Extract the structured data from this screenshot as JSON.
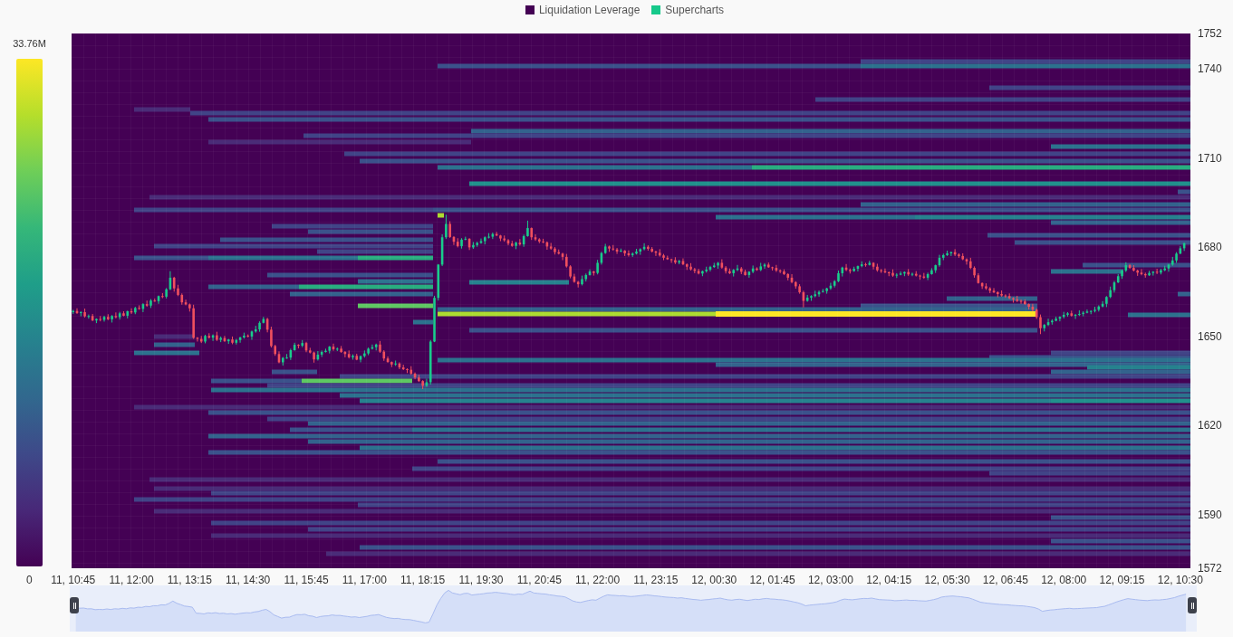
{
  "legend": [
    {
      "label": "Liquidation Leverage",
      "color": "#440154"
    },
    {
      "label": "Supercharts",
      "color": "#17c98b"
    }
  ],
  "color_scale": {
    "max_label": "33.76M",
    "min_label": "0"
  },
  "heatmap": {
    "chart_data": {
      "type": "candlestick",
      "ylim": [
        1572,
        1752
      ],
      "yticks": [
        {
          "value": 1752,
          "label": "1752"
        },
        {
          "value": 1740,
          "label": "1740"
        },
        {
          "value": 1710,
          "label": "1710"
        },
        {
          "value": 1680,
          "label": "1680"
        },
        {
          "value": 1650,
          "label": "1650"
        },
        {
          "value": 1620,
          "label": "1620"
        },
        {
          "value": 1590,
          "label": "1590"
        },
        {
          "value": 1572,
          "label": "1572"
        }
      ],
      "categories": [
        "11, 10:45",
        null,
        null,
        null,
        null,
        null,
        null,
        null,
        null,
        null,
        null,
        null,
        null,
        null,
        null,
        "11, 12:00",
        null,
        null,
        null,
        null,
        null,
        null,
        null,
        null,
        null,
        null,
        null,
        null,
        null,
        null,
        "11, 13:15",
        null,
        null,
        null,
        null,
        null,
        null,
        null,
        null,
        null,
        null,
        null,
        null,
        null,
        null,
        "11, 14:30",
        null,
        null,
        null,
        null,
        null,
        null,
        null,
        null,
        null,
        null,
        null,
        null,
        null,
        null,
        "11, 15:45",
        null,
        null,
        null,
        null,
        null,
        null,
        null,
        null,
        null,
        null,
        null,
        null,
        null,
        null,
        "11, 17:00",
        null,
        null,
        null,
        null,
        null,
        null,
        null,
        null,
        null,
        null,
        null,
        null,
        null,
        null,
        "11, 18:15",
        null,
        null,
        null,
        null,
        null,
        null,
        null,
        null,
        null,
        null,
        null,
        null,
        null,
        null,
        "11, 19:30",
        null,
        null,
        null,
        null,
        null,
        null,
        null,
        null,
        null,
        null,
        null,
        null,
        null,
        null,
        "11, 20:45",
        null,
        null,
        null,
        null,
        null,
        null,
        null,
        null,
        null,
        null,
        null,
        null,
        null,
        null,
        "11, 22:00",
        null,
        null,
        null,
        null,
        null,
        null,
        null,
        null,
        null,
        null,
        null,
        null,
        null,
        null,
        "11, 23:15",
        null,
        null,
        null,
        null,
        null,
        null,
        null,
        null,
        null,
        null,
        null,
        null,
        null,
        null,
        "12, 00:30",
        null,
        null,
        null,
        null,
        null,
        null,
        null,
        null,
        null,
        null,
        null,
        null,
        null,
        null,
        "12, 01:45",
        null,
        null,
        null,
        null,
        null,
        null,
        null,
        null,
        null,
        null,
        null,
        null,
        null,
        null,
        "12, 03:00",
        null,
        null,
        null,
        null,
        null,
        null,
        null,
        null,
        null,
        null,
        null,
        null,
        null,
        null,
        "12, 04:15",
        null,
        null,
        null,
        null,
        null,
        null,
        null,
        null,
        null,
        null,
        null,
        null,
        null,
        null,
        "12, 05:30",
        null,
        null,
        null,
        null,
        null,
        null,
        null,
        null,
        null,
        null,
        null,
        null,
        null,
        null,
        "12, 06:45",
        null,
        null,
        null,
        null,
        null,
        null,
        null,
        null,
        null,
        null,
        null,
        null,
        null,
        null,
        "12, 08:00",
        null,
        null,
        null,
        null,
        null,
        null,
        null,
        null,
        null,
        null,
        null,
        null,
        null,
        null,
        "12, 09:15",
        null,
        null,
        null,
        null,
        null,
        null,
        null,
        null,
        null,
        null,
        null,
        null,
        null,
        null,
        "12, 10:30",
        null
      ],
      "ohlc": [
        [
          1658.2,
          1659.0,
          1657.6,
          1658.6
        ],
        [
          1658.6,
          1659.5,
          1657.6,
          1657.9
        ],
        [
          1657.9,
          1658.5,
          1656.8,
          1658.2
        ],
        [
          1658.2,
          1659.4,
          1656.4,
          1656.8
        ],
        [
          1656.8,
          1657.4,
          1656.0,
          1656.9
        ],
        [
          1656.9,
          1657.6,
          1655.2,
          1655.4
        ],
        [
          1655.4,
          1656.1,
          1654.5,
          1655.9
        ],
        [
          1655.9,
          1656.9,
          1655.1,
          1655.6
        ],
        [
          1655.6,
          1657.0,
          1655.0,
          1656.6
        ],
        [
          1656.6,
          1657.5,
          1655.5,
          1655.8
        ],
        [
          1655.8,
          1657.2,
          1654.7,
          1656.9
        ],
        [
          1656.9,
          1658.1,
          1656.1,
          1656.5
        ],
        [
          1656.5,
          1658.3,
          1655.7,
          1657.8
        ],
        [
          1657.8,
          1658.5,
          1656.8,
          1657.0
        ],
        [
          1657.0,
          1658.7,
          1656.1,
          1658.5
        ],
        [
          1658.5,
          1659.5,
          1657.6,
          1658.1
        ],
        [
          1658.1,
          1660.0,
          1657.5,
          1659.6
        ],
        [
          1659.6,
          1660.5,
          1659.0,
          1659.3
        ],
        [
          1659.3,
          1661.2,
          1658.2,
          1660.9
        ],
        [
          1660.9,
          1662.1,
          1660.0,
          1660.4
        ],
        [
          1660.4,
          1662.6,
          1659.6,
          1662.1
        ],
        [
          1662.1,
          1662.8,
          1661.7,
          1661.9
        ],
        [
          1661.9,
          1663.8,
          1661.0,
          1663.6
        ],
        [
          1663.6,
          1664.6,
          1662.9,
          1663.4
        ],
        [
          1663.4,
          1666.3,
          1662.8,
          1665.9
        ],
        [
          1665.9,
          1672.0,
          1665.6,
          1669.8
        ],
        [
          1669.8,
          1670.1,
          1665.1,
          1666.2
        ],
        [
          1666.2,
          1667.4,
          1663.6,
          1664.0
        ],
        [
          1664.0,
          1664.5,
          1660.7,
          1661.5
        ],
        [
          1661.5,
          1662.4,
          1660.5,
          1660.8
        ],
        [
          1660.8,
          1661.1,
          1658.4,
          1659.5
        ],
        [
          1659.5,
          1660.7,
          1649.2,
          1649.6
        ],
        [
          1649.6,
          1649.8,
          1648.3,
          1649.2
        ],
        [
          1649.2,
          1650.2,
          1647.8,
          1648.3
        ],
        [
          1648.3,
          1650.6,
          1647.7,
          1650.2
        ],
        [
          1650.2,
          1651.1,
          1649.3,
          1649.6
        ],
        [
          1649.6,
          1650.7,
          1648.5,
          1650.4
        ],
        [
          1650.4,
          1651.6,
          1648.5,
          1648.9
        ],
        [
          1648.9,
          1650.0,
          1648.1,
          1649.5
        ],
        [
          1649.5,
          1650.2,
          1648.2,
          1648.4
        ],
        [
          1648.4,
          1649.2,
          1647.5,
          1649.0
        ],
        [
          1649.0,
          1650.0,
          1647.4,
          1647.9
        ],
        [
          1647.9,
          1649.2,
          1647.3,
          1648.8
        ],
        [
          1648.8,
          1649.9,
          1647.9,
          1649.7
        ],
        [
          1649.7,
          1651.3,
          1649.3,
          1650.3
        ],
        [
          1650.3,
          1650.7,
          1649.7,
          1650.0
        ],
        [
          1650.0,
          1652.0,
          1648.9,
          1651.7
        ],
        [
          1651.7,
          1653.6,
          1651.3,
          1652.4
        ],
        [
          1652.4,
          1655.1,
          1651.6,
          1654.6
        ],
        [
          1654.6,
          1656.6,
          1654.4,
          1655.9
        ],
        [
          1655.9,
          1656.3,
          1651.4,
          1652.3
        ],
        [
          1652.3,
          1653.3,
          1646.3,
          1646.8
        ],
        [
          1646.8,
          1647.2,
          1643.5,
          1644.1
        ],
        [
          1644.1,
          1645.0,
          1641.0,
          1641.3
        ],
        [
          1641.3,
          1643.1,
          1640.2,
          1642.8
        ],
        [
          1642.8,
          1644.1,
          1642.5,
          1642.9
        ],
        [
          1642.9,
          1645.9,
          1642.1,
          1645.4
        ],
        [
          1645.4,
          1647.9,
          1645.2,
          1647.2
        ],
        [
          1647.2,
          1647.4,
          1646.0,
          1646.9
        ],
        [
          1646.9,
          1648.8,
          1646.4,
          1647.8
        ],
        [
          1647.8,
          1648.2,
          1644.7,
          1645.3
        ],
        [
          1645.3,
          1646.2,
          1644.3,
          1644.6
        ],
        [
          1644.6,
          1644.9,
          1641.2,
          1642.3
        ],
        [
          1642.3,
          1645.1,
          1641.9,
          1643.9
        ],
        [
          1643.9,
          1645.3,
          1643.1,
          1644.8
        ],
        [
          1644.8,
          1645.9,
          1644.6,
          1645.2
        ],
        [
          1645.2,
          1646.8,
          1644.3,
          1646.6
        ],
        [
          1646.6,
          1647.6,
          1645.2,
          1645.7
        ],
        [
          1645.7,
          1646.3,
          1645.1,
          1645.9
        ],
        [
          1645.9,
          1646.8,
          1644.5,
          1644.8
        ],
        [
          1644.8,
          1645.1,
          1643.0,
          1644.1
        ],
        [
          1644.1,
          1645.3,
          1642.6,
          1643.0
        ],
        [
          1643.0,
          1644.0,
          1642.2,
          1643.5
        ],
        [
          1643.5,
          1644.2,
          1642.0,
          1642.2
        ],
        [
          1642.2,
          1643.6,
          1641.3,
          1643.4
        ],
        [
          1643.4,
          1645.3,
          1642.9,
          1644.3
        ],
        [
          1644.3,
          1646.3,
          1643.7,
          1645.9
        ],
        [
          1645.9,
          1647.3,
          1645.6,
          1646.4
        ],
        [
          1646.4,
          1647.6,
          1645.3,
          1647.3
        ],
        [
          1647.3,
          1648.5,
          1644.5,
          1644.9
        ],
        [
          1644.9,
          1645.4,
          1641.8,
          1642.6
        ],
        [
          1642.6,
          1643.3,
          1641.2,
          1641.4
        ],
        [
          1641.4,
          1641.6,
          1639.7,
          1640.6
        ],
        [
          1640.6,
          1641.9,
          1640.1,
          1640.9
        ],
        [
          1640.9,
          1641.3,
          1639.0,
          1639.6
        ],
        [
          1639.6,
          1640.5,
          1638.7,
          1639.0
        ],
        [
          1639.0,
          1639.3,
          1637.7,
          1638.8
        ],
        [
          1638.8,
          1640.0,
          1637.1,
          1637.5
        ],
        [
          1637.5,
          1637.9,
          1635.6,
          1636.2
        ],
        [
          1636.2,
          1637.1,
          1634.7,
          1635.0
        ],
        [
          1635.0,
          1635.3,
          1632.3,
          1633.4
        ],
        [
          1633.4,
          1635.8,
          1633.0,
          1634.6
        ],
        [
          1634.6,
          1648.8,
          1633.8,
          1648.3
        ],
        [
          1648.3,
          1663.7,
          1648.1,
          1663.0
        ],
        [
          1663.0,
          1674.4,
          1662.1,
          1674.2
        ],
        [
          1674.2,
          1684.4,
          1673.7,
          1683.4
        ],
        [
          1683.4,
          1691.0,
          1682.8,
          1687.9
        ],
        [
          1687.9,
          1688.8,
          1683.2,
          1683.5
        ],
        [
          1683.5,
          1683.8,
          1680.8,
          1681.9
        ],
        [
          1681.9,
          1683.1,
          1680.0,
          1680.4
        ],
        [
          1680.4,
          1683.1,
          1679.6,
          1682.6
        ],
        [
          1682.6,
          1683.6,
          1682.4,
          1682.9
        ],
        [
          1682.9,
          1683.1,
          1679.1,
          1680.0
        ],
        [
          1680.0,
          1681.8,
          1679.5,
          1680.8
        ],
        [
          1680.8,
          1681.9,
          1680.2,
          1681.5
        ],
        [
          1681.5,
          1683.0,
          1681.2,
          1682.1
        ],
        [
          1682.1,
          1683.7,
          1681.0,
          1683.4
        ],
        [
          1683.4,
          1684.8,
          1683.0,
          1683.6
        ],
        [
          1683.6,
          1685.0,
          1682.8,
          1684.5
        ],
        [
          1684.5,
          1685.2,
          1683.8,
          1684.0
        ],
        [
          1684.0,
          1684.2,
          1682.1,
          1683.0
        ],
        [
          1683.0,
          1684.0,
          1681.9,
          1682.4
        ],
        [
          1682.4,
          1682.8,
          1680.7,
          1681.3
        ],
        [
          1681.3,
          1682.2,
          1680.2,
          1680.5
        ],
        [
          1680.5,
          1681.9,
          1679.4,
          1681.6
        ],
        [
          1681.6,
          1682.8,
          1680.6,
          1681.0
        ],
        [
          1681.0,
          1684.3,
          1680.2,
          1683.8
        ],
        [
          1683.8,
          1689.0,
          1683.6,
          1686.5
        ],
        [
          1686.5,
          1686.7,
          1682.5,
          1683.4
        ],
        [
          1683.4,
          1684.4,
          1682.2,
          1682.7
        ],
        [
          1682.7,
          1683.1,
          1681.4,
          1682.0
        ],
        [
          1682.0,
          1682.9,
          1681.4,
          1681.7
        ],
        [
          1681.7,
          1682.0,
          1679.2,
          1680.3
        ],
        [
          1680.3,
          1681.5,
          1679.2,
          1679.6
        ],
        [
          1679.6,
          1680.1,
          1677.6,
          1678.4
        ],
        [
          1678.4,
          1679.3,
          1677.6,
          1677.9
        ],
        [
          1677.9,
          1678.2,
          1675.7,
          1676.8
        ],
        [
          1676.8,
          1677.8,
          1673.2,
          1673.6
        ],
        [
          1673.6,
          1674.0,
          1669.6,
          1670.2
        ],
        [
          1670.2,
          1671.1,
          1668.1,
          1668.4
        ],
        [
          1668.4,
          1668.7,
          1666.5,
          1667.6
        ],
        [
          1667.6,
          1670.5,
          1667.2,
          1669.3
        ],
        [
          1669.3,
          1671.2,
          1668.5,
          1670.7
        ],
        [
          1670.7,
          1672.6,
          1670.5,
          1671.9
        ],
        [
          1671.9,
          1672.1,
          1670.5,
          1671.4
        ],
        [
          1671.4,
          1675.8,
          1670.9,
          1674.8
        ],
        [
          1674.8,
          1678.5,
          1674.2,
          1678.1
        ],
        [
          1678.1,
          1681.2,
          1677.8,
          1680.3
        ],
        [
          1680.3,
          1680.6,
          1678.5,
          1679.6
        ],
        [
          1679.6,
          1680.8,
          1678.9,
          1679.3
        ],
        [
          1679.3,
          1679.8,
          1677.8,
          1678.6
        ],
        [
          1678.6,
          1679.6,
          1678.4,
          1678.9
        ],
        [
          1678.9,
          1679.1,
          1677.1,
          1678.0
        ],
        [
          1678.0,
          1679.0,
          1676.9,
          1677.4
        ],
        [
          1677.4,
          1678.3,
          1676.8,
          1677.9
        ],
        [
          1677.9,
          1679.5,
          1677.6,
          1678.6
        ],
        [
          1678.6,
          1679.7,
          1677.5,
          1679.4
        ],
        [
          1679.4,
          1681.4,
          1679.0,
          1680.2
        ],
        [
          1680.2,
          1680.7,
          1678.9,
          1679.5
        ],
        [
          1679.5,
          1680.1,
          1678.3,
          1678.6
        ],
        [
          1678.6,
          1678.9,
          1677.1,
          1678.2
        ],
        [
          1678.2,
          1679.4,
          1676.9,
          1677.3
        ],
        [
          1677.3,
          1677.8,
          1675.7,
          1676.5
        ],
        [
          1676.5,
          1677.2,
          1675.8,
          1676.0
        ],
        [
          1676.0,
          1676.2,
          1674.8,
          1675.7
        ],
        [
          1675.7,
          1676.7,
          1674.4,
          1674.9
        ],
        [
          1674.9,
          1675.8,
          1674.3,
          1675.4
        ],
        [
          1675.4,
          1676.3,
          1674.0,
          1674.3
        ],
        [
          1674.3,
          1674.6,
          1672.4,
          1673.5
        ],
        [
          1673.5,
          1674.7,
          1672.2,
          1672.6
        ],
        [
          1672.6,
          1673.1,
          1671.3,
          1672.1
        ],
        [
          1672.1,
          1672.8,
          1670.9,
          1671.2
        ],
        [
          1671.2,
          1672.2,
          1670.3,
          1672.0
        ],
        [
          1672.0,
          1673.5,
          1671.5,
          1672.5
        ],
        [
          1672.5,
          1673.8,
          1671.9,
          1673.4
        ],
        [
          1673.4,
          1674.8,
          1673.1,
          1673.9
        ],
        [
          1673.9,
          1675.1,
          1672.8,
          1674.8
        ],
        [
          1674.8,
          1676.0,
          1672.8,
          1673.2
        ],
        [
          1673.2,
          1673.7,
          1671.2,
          1672.0
        ],
        [
          1672.0,
          1672.9,
          1671.0,
          1671.3
        ],
        [
          1671.3,
          1672.7,
          1670.2,
          1672.4
        ],
        [
          1672.4,
          1674.1,
          1672.0,
          1672.9
        ],
        [
          1672.9,
          1673.4,
          1671.0,
          1671.8
        ],
        [
          1671.8,
          1672.5,
          1670.5,
          1670.7
        ],
        [
          1670.7,
          1672.0,
          1669.8,
          1671.8
        ],
        [
          1671.8,
          1673.9,
          1671.3,
          1672.9
        ],
        [
          1672.9,
          1673.3,
          1672.1,
          1672.4
        ],
        [
          1672.4,
          1674.8,
          1672.0,
          1673.6
        ],
        [
          1673.6,
          1674.7,
          1672.8,
          1674.2
        ],
        [
          1674.2,
          1674.9,
          1673.1,
          1673.3
        ],
        [
          1673.3,
          1673.5,
          1672.2,
          1673.1
        ],
        [
          1673.1,
          1674.1,
          1671.7,
          1672.2
        ],
        [
          1672.2,
          1672.6,
          1671.3,
          1671.9
        ],
        [
          1671.9,
          1672.6,
          1670.7,
          1671.0
        ],
        [
          1671.0,
          1671.3,
          1668.9,
          1669.8
        ],
        [
          1669.8,
          1671.0,
          1667.9,
          1668.3
        ],
        [
          1668.3,
          1668.6,
          1666.1,
          1666.9
        ],
        [
          1666.9,
          1667.6,
          1664.4,
          1664.9
        ],
        [
          1664.9,
          1665.4,
          1659.8,
          1662.0
        ],
        [
          1662.0,
          1664.0,
          1661.7,
          1663.1
        ],
        [
          1663.1,
          1663.9,
          1662.0,
          1663.6
        ],
        [
          1663.6,
          1665.4,
          1663.2,
          1664.2
        ],
        [
          1664.2,
          1665.5,
          1663.4,
          1665.0
        ],
        [
          1665.0,
          1666.0,
          1664.8,
          1665.3
        ],
        [
          1665.3,
          1666.4,
          1664.4,
          1666.2
        ],
        [
          1666.2,
          1668.1,
          1665.7,
          1667.1
        ],
        [
          1667.1,
          1669.0,
          1666.5,
          1668.6
        ],
        [
          1668.6,
          1672.2,
          1668.3,
          1671.3
        ],
        [
          1671.3,
          1673.5,
          1670.2,
          1673.2
        ],
        [
          1673.2,
          1674.4,
          1672.0,
          1672.4
        ],
        [
          1672.4,
          1672.9,
          1671.2,
          1672.0
        ],
        [
          1672.0,
          1673.5,
          1671.8,
          1672.8
        ],
        [
          1672.8,
          1673.9,
          1671.9,
          1673.7
        ],
        [
          1673.7,
          1675.3,
          1673.3,
          1674.3
        ],
        [
          1674.3,
          1674.8,
          1673.5,
          1674.1
        ],
        [
          1674.1,
          1675.5,
          1673.9,
          1674.8
        ],
        [
          1674.8,
          1675.0,
          1672.6,
          1673.5
        ],
        [
          1673.5,
          1674.5,
          1671.8,
          1672.3
        ],
        [
          1672.3,
          1672.7,
          1671.4,
          1672.0
        ],
        [
          1672.0,
          1672.9,
          1671.3,
          1671.6
        ],
        [
          1671.6,
          1671.9,
          1670.3,
          1671.4
        ],
        [
          1671.4,
          1672.6,
          1670.1,
          1670.5
        ],
        [
          1670.5,
          1671.3,
          1669.7,
          1670.8
        ],
        [
          1670.8,
          1671.9,
          1670.6,
          1671.2
        ],
        [
          1671.2,
          1671.9,
          1670.3,
          1671.7
        ],
        [
          1671.7,
          1672.7,
          1670.4,
          1670.9
        ],
        [
          1670.9,
          1671.5,
          1670.3,
          1671.1
        ],
        [
          1671.1,
          1672.0,
          1670.2,
          1670.5
        ],
        [
          1670.5,
          1670.8,
          1669.1,
          1670.2
        ],
        [
          1670.2,
          1671.4,
          1669.4,
          1669.8
        ],
        [
          1669.8,
          1671.5,
          1669.0,
          1671.0
        ],
        [
          1671.0,
          1673.0,
          1670.8,
          1672.3
        ],
        [
          1672.3,
          1674.2,
          1671.4,
          1674.0
        ],
        [
          1674.0,
          1677.5,
          1673.5,
          1676.5
        ],
        [
          1676.5,
          1677.9,
          1675.7,
          1677.4
        ],
        [
          1677.4,
          1678.9,
          1677.1,
          1678.0
        ],
        [
          1678.0,
          1678.6,
          1677.1,
          1678.4
        ],
        [
          1678.4,
          1679.4,
          1677.1,
          1677.6
        ],
        [
          1677.6,
          1678.0,
          1676.5,
          1677.1
        ],
        [
          1677.1,
          1678.0,
          1675.7,
          1676.0
        ],
        [
          1676.0,
          1676.3,
          1674.2,
          1675.3
        ],
        [
          1675.3,
          1676.5,
          1672.7,
          1673.1
        ],
        [
          1673.1,
          1673.6,
          1669.8,
          1670.6
        ],
        [
          1670.6,
          1671.3,
          1667.8,
          1668.0
        ],
        [
          1668.0,
          1668.2,
          1666.0,
          1666.9
        ],
        [
          1666.9,
          1667.9,
          1665.7,
          1666.2
        ],
        [
          1666.2,
          1666.6,
          1664.6,
          1665.4
        ],
        [
          1665.4,
          1666.3,
          1664.6,
          1664.9
        ],
        [
          1664.9,
          1665.2,
          1663.2,
          1664.3
        ],
        [
          1664.3,
          1665.5,
          1663.4,
          1663.8
        ],
        [
          1663.8,
          1664.2,
          1663.0,
          1663.6
        ],
        [
          1663.6,
          1664.5,
          1662.6,
          1662.9
        ],
        [
          1662.9,
          1663.2,
          1661.4,
          1662.5
        ],
        [
          1662.5,
          1663.7,
          1661.6,
          1662.0
        ],
        [
          1662.0,
          1662.5,
          1661.0,
          1661.8
        ],
        [
          1661.8,
          1662.5,
          1660.7,
          1660.9
        ],
        [
          1660.9,
          1661.1,
          1659.1,
          1660.0
        ],
        [
          1660.0,
          1661.0,
          1658.5,
          1659.0
        ],
        [
          1659.0,
          1659.4,
          1655.9,
          1656.5
        ],
        [
          1656.5,
          1657.4,
          1650.8,
          1652.8
        ],
        [
          1652.8,
          1654.2,
          1651.7,
          1653.9
        ],
        [
          1653.9,
          1656.0,
          1653.5,
          1654.8
        ],
        [
          1654.8,
          1655.8,
          1654.0,
          1655.3
        ],
        [
          1655.3,
          1656.7,
          1655.1,
          1656.0
        ],
        [
          1656.0,
          1656.8,
          1655.1,
          1656.6
        ],
        [
          1656.6,
          1658.3,
          1656.1,
          1657.3
        ],
        [
          1657.3,
          1658.2,
          1656.7,
          1657.8
        ],
        [
          1657.8,
          1658.7,
          1656.7,
          1657.0
        ],
        [
          1657.0,
          1657.6,
          1655.9,
          1657.3
        ],
        [
          1657.3,
          1658.8,
          1656.9,
          1657.6
        ],
        [
          1657.6,
          1658.5,
          1656.8,
          1658.0
        ],
        [
          1658.0,
          1659.1,
          1657.8,
          1658.4
        ],
        [
          1658.4,
          1658.8,
          1657.5,
          1658.6
        ],
        [
          1658.6,
          1660.0,
          1658.1,
          1659.0
        ],
        [
          1659.0,
          1660.5,
          1658.4,
          1660.1
        ],
        [
          1660.1,
          1661.9,
          1659.8,
          1661.0
        ],
        [
          1661.0,
          1663.6,
          1659.9,
          1663.3
        ],
        [
          1663.3,
          1666.8,
          1662.9,
          1665.6
        ],
        [
          1665.6,
          1668.7,
          1664.8,
          1668.2
        ],
        [
          1668.2,
          1671.0,
          1668.0,
          1670.3
        ],
        [
          1670.3,
          1672.4,
          1669.4,
          1672.2
        ],
        [
          1672.2,
          1675.0,
          1671.7,
          1674.0
        ],
        [
          1674.0,
          1674.4,
          1672.8,
          1673.1
        ],
        [
          1673.1,
          1674.0,
          1671.9,
          1672.2
        ],
        [
          1672.2,
          1672.5,
          1670.4,
          1671.5
        ],
        [
          1671.5,
          1672.7,
          1670.6,
          1671.0
        ],
        [
          1671.0,
          1671.5,
          1669.8,
          1670.6
        ],
        [
          1670.6,
          1672.1,
          1670.4,
          1671.4
        ],
        [
          1671.4,
          1672.0,
          1670.5,
          1671.8
        ],
        [
          1671.8,
          1672.8,
          1671.0,
          1671.5
        ],
        [
          1671.5,
          1672.8,
          1670.9,
          1672.3
        ],
        [
          1672.3,
          1673.8,
          1672.0,
          1672.9
        ],
        [
          1672.9,
          1674.5,
          1671.8,
          1674.2
        ],
        [
          1674.2,
          1676.8,
          1673.8,
          1675.6
        ],
        [
          1675.6,
          1678.4,
          1674.8,
          1677.9
        ],
        [
          1677.9,
          1680.4,
          1677.7,
          1679.7
        ],
        [
          1679.7,
          1681.6,
          1678.8,
          1681.4
        ]
      ]
    }
  },
  "navigator": {
    "handles": [
      {
        "level": 0
      },
      {
        "level": 1
      }
    ]
  }
}
